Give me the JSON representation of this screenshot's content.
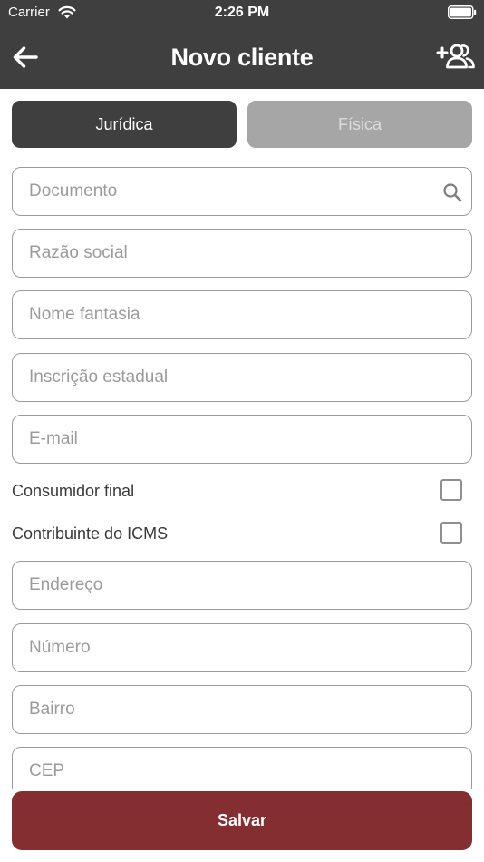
{
  "status_bar": {
    "carrier": "Carrier",
    "time": "2:26 PM"
  },
  "nav": {
    "title": "Novo cliente",
    "back_icon": "arrow-left-icon",
    "add_user_icon": "user-plus-icon"
  },
  "person_type": {
    "options": [
      "Jurídica",
      "Física"
    ],
    "selected": "Jurídica"
  },
  "fields": {
    "documento": {
      "placeholder": "Documento",
      "value": ""
    },
    "razao_social": {
      "placeholder": "Razão social",
      "value": ""
    },
    "nome_fantasia": {
      "placeholder": "Nome fantasia",
      "value": ""
    },
    "inscricao_estadual": {
      "placeholder": "Inscrição estadual",
      "value": ""
    },
    "email": {
      "placeholder": "E-mail",
      "value": ""
    },
    "endereco": {
      "placeholder": "Endereço",
      "value": ""
    },
    "numero": {
      "placeholder": "Número",
      "value": ""
    },
    "bairro": {
      "placeholder": "Bairro",
      "value": ""
    },
    "cep": {
      "placeholder": "CEP",
      "value": ""
    }
  },
  "checks": {
    "consumidor_final": {
      "label": "Consumidor final",
      "checked": false
    },
    "contribuinte_icms": {
      "label": "Contribuinte do ICMS",
      "checked": false
    }
  },
  "actions": {
    "save_label": "Salvar"
  },
  "colors": {
    "header": "#3f3f3f",
    "segment_active": "#3f3f3f",
    "segment_inactive": "#a6a6a6",
    "save": "#842e31"
  }
}
